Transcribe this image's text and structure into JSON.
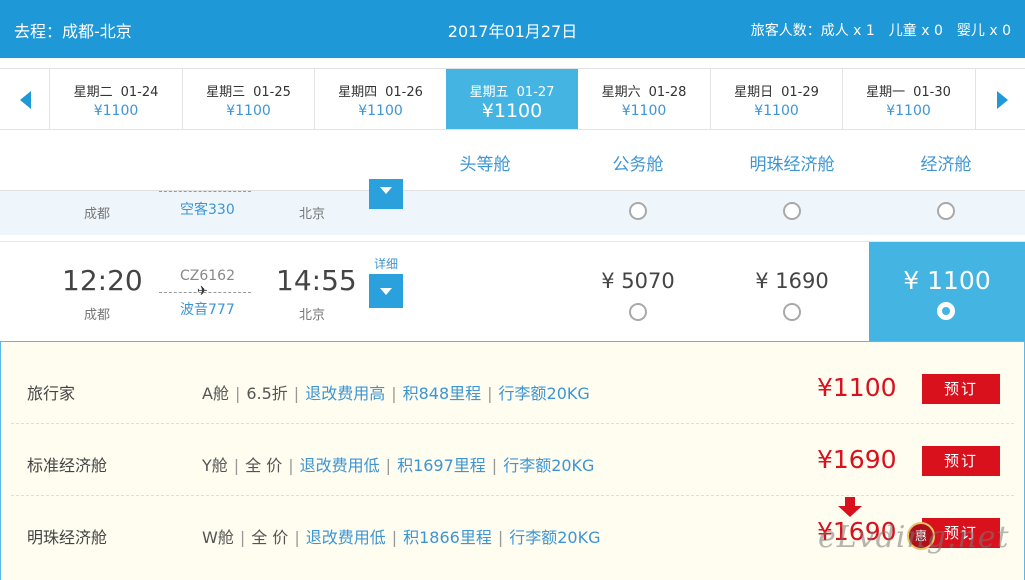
{
  "header": {
    "route": "去程：成都-北京",
    "date": "2017年01月27日",
    "passengers": "旅客人数：成人 x 1　儿童 x 0　婴儿 x 0"
  },
  "date_bar": {
    "days": [
      {
        "weekday": "星期二",
        "date": "01-24",
        "price": "¥1100",
        "active": false
      },
      {
        "weekday": "星期三",
        "date": "01-25",
        "price": "¥1100",
        "active": false
      },
      {
        "weekday": "星期四",
        "date": "01-26",
        "price": "¥1100",
        "active": false
      },
      {
        "weekday": "星期五",
        "date": "01-27",
        "price": "¥1100",
        "active": true
      },
      {
        "weekday": "星期六",
        "date": "01-28",
        "price": "¥1100",
        "active": false
      },
      {
        "weekday": "星期日",
        "date": "01-29",
        "price": "¥1100",
        "active": false
      },
      {
        "weekday": "星期一",
        "date": "01-30",
        "price": "¥1100",
        "active": false
      }
    ]
  },
  "cabins": [
    "头等舱",
    "公务舱",
    "明珠经济舱",
    "经济舱"
  ],
  "flight_partial": {
    "dep_city": "成都",
    "arr_city": "北京",
    "aircraft": "空客330"
  },
  "flight_main": {
    "dep_time": "12:20",
    "dep_city": "成都",
    "flight_no": "CZ6162",
    "plane_glyph": "✈",
    "aircraft": "波音777",
    "arr_time": "14:55",
    "arr_city": "北京",
    "detail": "详细",
    "prices": {
      "first": "¥ 5070",
      "business": "¥ 1690",
      "premium_economy": "",
      "economy": "¥ 1100"
    }
  },
  "fares": [
    {
      "name": "旅行家",
      "cabin": "A舱",
      "discount": "6.5折",
      "refund": "退改费用高",
      "miles": "积848里程",
      "baggage": "行李额20KG",
      "price": "¥1100",
      "book": "预订"
    },
    {
      "name": "标准经济舱",
      "cabin": "Y舱",
      "discount": "全 价",
      "refund": "退改费用低",
      "miles": "积1697里程",
      "baggage": "行李额20KG",
      "price": "¥1690",
      "book": "预订"
    },
    {
      "name": "明珠经济舱",
      "cabin": "W舱",
      "discount": "全 价",
      "refund": "退改费用低",
      "miles": "积1866里程",
      "baggage": "行李额20KG",
      "price": "¥1690",
      "book": "预订"
    }
  ],
  "badge": "惠",
  "watermark": "eLvding.net",
  "colors": {
    "primary": "#1e98d7",
    "selected": "#44b4e2",
    "price_red": "#d9111d",
    "link_blue": "#3d95d3"
  }
}
